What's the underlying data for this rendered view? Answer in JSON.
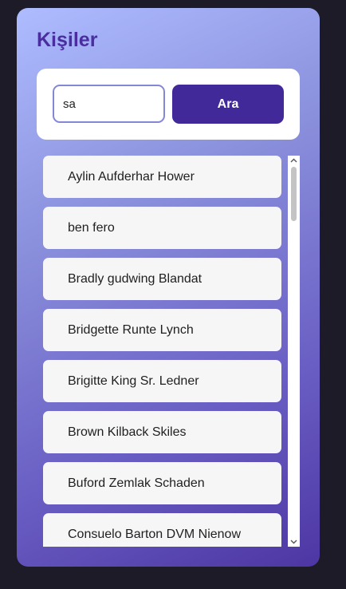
{
  "page": {
    "title": "Kişiler"
  },
  "search": {
    "value": "sa",
    "button_label": "Ara"
  },
  "contacts": [
    "Aylin Aufderhar Hower",
    "ben fero",
    "Bradly gudwing Blandat",
    "Bridgette Runte Lynch",
    "Brigitte King Sr. Ledner",
    "Brown Kilback Skiles",
    "Buford Zemlak Schaden",
    "Consuelo Barton DVM Nienow"
  ],
  "colors": {
    "title": "#4a2ea0",
    "button": "#42299a",
    "input_border": "#8487d6",
    "card_gradient_start": "#aebcff",
    "card_gradient_end": "#4d36a3"
  },
  "icons": {
    "scroll_up": "triangle-up",
    "scroll_down": "triangle-down"
  }
}
